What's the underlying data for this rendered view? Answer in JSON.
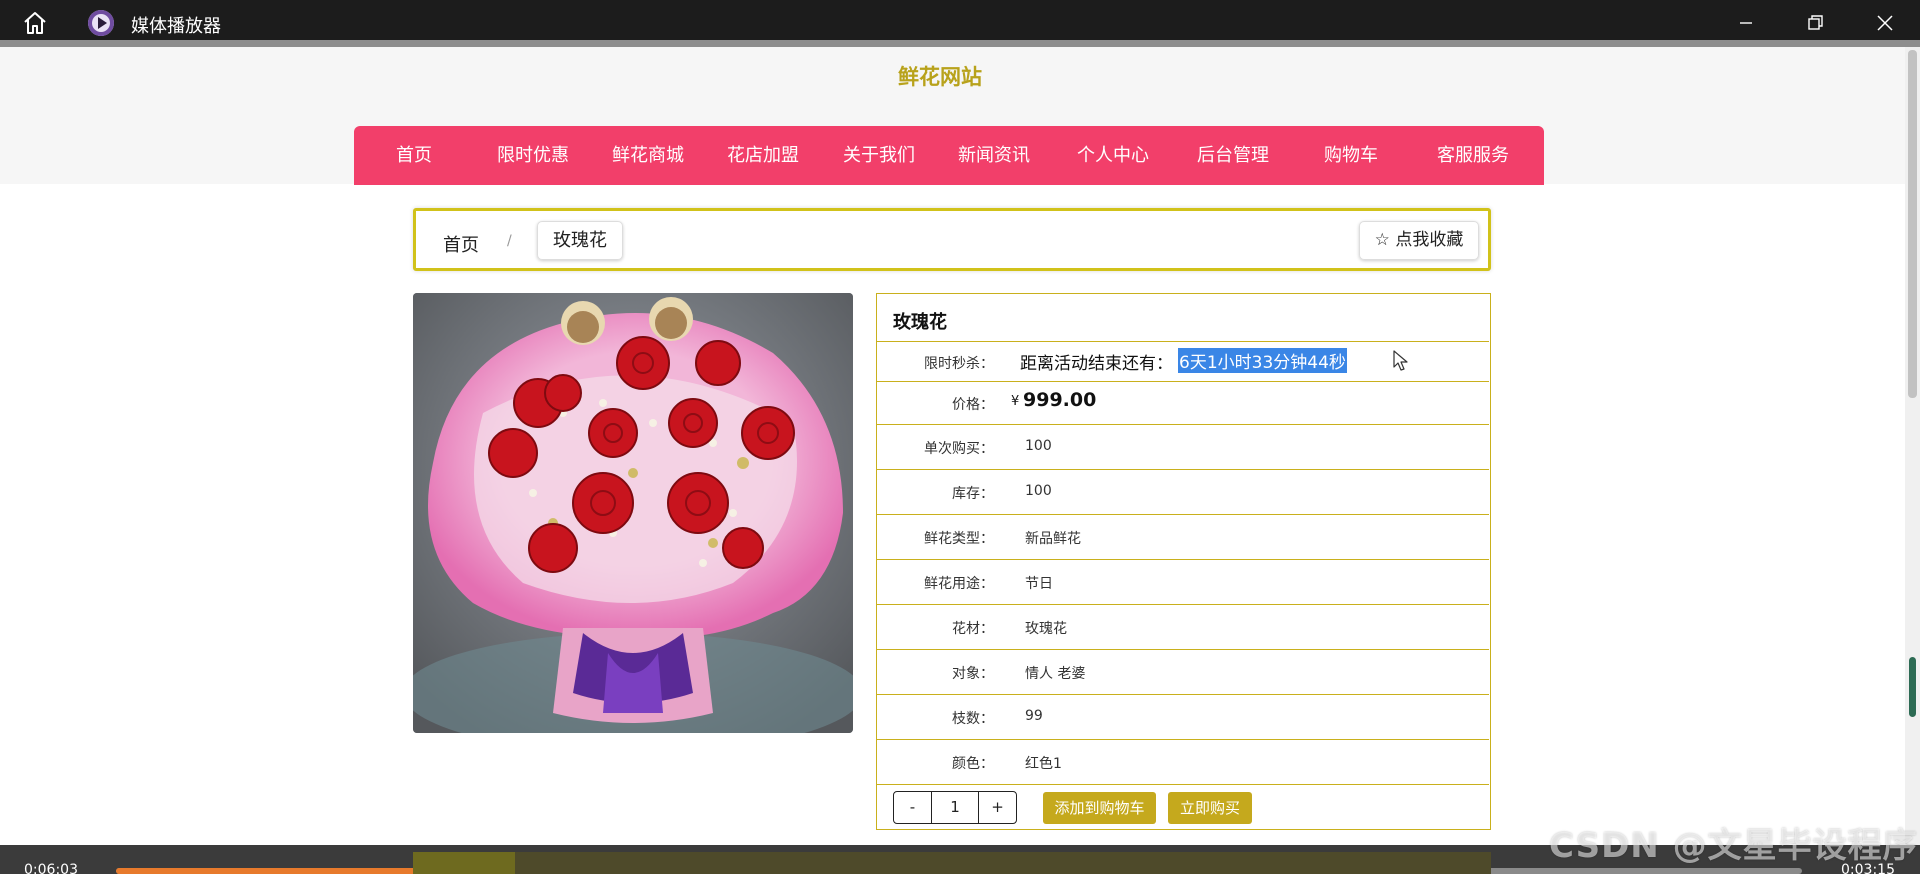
{
  "window": {
    "title": "媒体播放器",
    "home_icon": "home-icon",
    "app_icon": "media-player-icon",
    "controls": [
      "minimize-icon",
      "restore-icon",
      "close-icon"
    ]
  },
  "site": {
    "title": "鲜花网站",
    "nav": [
      "首页",
      "限时优惠",
      "鲜花商城",
      "花店加盟",
      "关于我们",
      "新闻资讯",
      "个人中心",
      "后台管理",
      "购物车",
      "客服服务"
    ],
    "nav_color": "#f23f6a",
    "accent": "#c9b01c"
  },
  "breadcrumb": {
    "home": "首页",
    "separator": "/",
    "current": "玫瑰花",
    "favorite_label": "☆ 点我收藏"
  },
  "product": {
    "name": "玫瑰花",
    "countdown_label": "限时秒杀：",
    "countdown_prefix": "距离活动结束还有：",
    "countdown_value": "6天1小时33分钟44秒",
    "price_label": "价格：",
    "currency": "¥",
    "price": "999.00",
    "fields": [
      {
        "label": "单次购买：",
        "value": "100"
      },
      {
        "label": "库存：",
        "value": "100"
      },
      {
        "label": "鲜花类型：",
        "value": "新品鲜花"
      },
      {
        "label": "鲜花用途：",
        "value": "节日"
      },
      {
        "label": "花材：",
        "value": "玫瑰花"
      },
      {
        "label": "对象：",
        "value": "情人 老婆"
      },
      {
        "label": "枝数：",
        "value": "99"
      },
      {
        "label": "颜色：",
        "value": "红色1"
      }
    ],
    "quantity": {
      "minus": "-",
      "value": "1",
      "plus": "+"
    },
    "add_to_cart": "添加到购物车",
    "buy_now": "立即购买"
  },
  "player": {
    "elapsed": "0:06:03",
    "remaining": "0:03:15",
    "progress": 0.632
  },
  "watermark": "CSDN @文星毕设程序"
}
